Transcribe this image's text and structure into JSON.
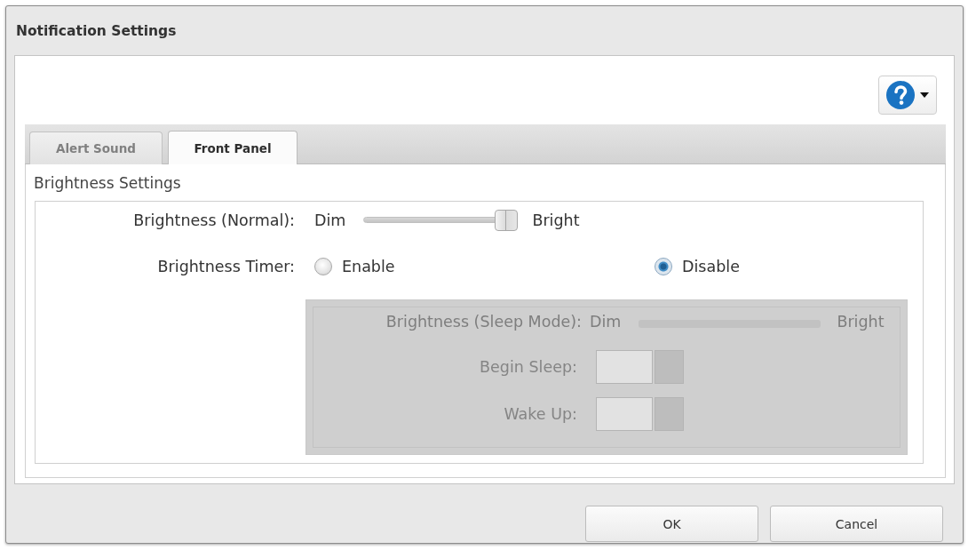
{
  "window": {
    "title": "Notification Settings"
  },
  "tabs": [
    {
      "label": "Alert Sound",
      "selected": false
    },
    {
      "label": "Front Panel",
      "selected": true
    }
  ],
  "section": {
    "title": "Brightness Settings",
    "brightness_normal": {
      "label": "Brightness (Normal):",
      "min_label": "Dim",
      "max_label": "Bright",
      "level": 1
    },
    "brightness_timer": {
      "label": "Brightness Timer:",
      "options": [
        {
          "label": "Enable",
          "selected": false
        },
        {
          "label": "Disable",
          "selected": true
        }
      ]
    },
    "sleep_settings": {
      "disabled": true,
      "brightness": {
        "label": "Brightness (Sleep Mode):",
        "min_label": "Dim",
        "max_label": "Bright"
      },
      "fields": [
        {
          "label": "Begin Sleep:"
        },
        {
          "label": "Wake Up:"
        }
      ]
    }
  },
  "buttons": [
    {
      "label": "OK"
    },
    {
      "label": "Cancel"
    }
  ]
}
